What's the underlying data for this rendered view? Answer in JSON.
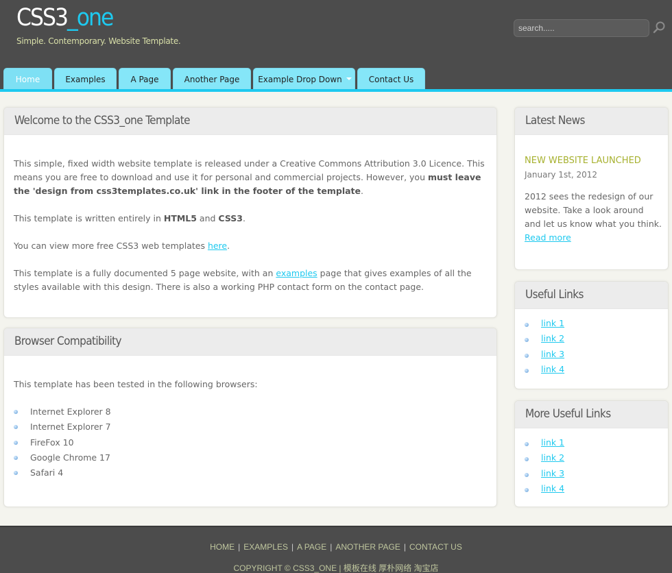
{
  "header": {
    "logo_main": "CSS3",
    "logo_accent": "_one",
    "slogan": "Simple. Contemporary. Website Template.",
    "search_placeholder": "search.....",
    "search_icon": "magnifier-icon"
  },
  "nav": {
    "tabs": [
      {
        "label": "Home"
      },
      {
        "label": "Examples"
      },
      {
        "label": "A Page"
      },
      {
        "label": "Another Page"
      },
      {
        "label": "Example Drop Down"
      },
      {
        "label": "Contact Us"
      }
    ]
  },
  "welcome": {
    "title": "Welcome to the CSS3_one Template",
    "p1_a": "This simple, fixed width website template is released under a Creative Commons Attribution 3.0 Licence. This means you are free to download and use it for personal and commercial projects. However, you ",
    "p1_b": "must leave the 'design from css3templates.co.uk' link in the footer of the template",
    "p1_c": ".",
    "p2_a": "This template is written entirely in ",
    "p2_b": "HTML5",
    "p2_c": " and ",
    "p2_d": "CSS3",
    "p2_e": ".",
    "p3_a": "You can view more free CSS3 web templates ",
    "p3_link": "here",
    "p3_c": ".",
    "p4_a": "This template is a fully documented 5 page website, with an ",
    "p4_link": "examples",
    "p4_c": " page that gives examples of all the styles available with this design. There is also a working PHP contact form on the contact page."
  },
  "browser": {
    "title": "Browser Compatibility",
    "intro": "This template has been tested in the following browsers:",
    "items": [
      "Internet Explorer 8",
      "Internet Explorer 7",
      "FireFox 10",
      "Google Chrome 17",
      "Safari 4"
    ]
  },
  "news": {
    "title": "Latest News",
    "headline": "NEW WEBSITE LAUNCHED",
    "date": "January 1st, 2012",
    "body": "2012 sees the redesign of our website. Take a look around and let us know what you think.",
    "read_more": "Read more"
  },
  "useful_links": {
    "title": "Useful Links",
    "items": [
      "link 1",
      "link 2",
      "link 3",
      "link 4"
    ]
  },
  "more_links": {
    "title": "More Useful Links",
    "items": [
      "link 1",
      "link 2",
      "link 3",
      "link 4"
    ]
  },
  "footer": {
    "links": [
      "HOME",
      "EXAMPLES",
      "A PAGE",
      "ANOTHER PAGE",
      "CONTACT US"
    ],
    "separator": "|",
    "copyright": "COPYRIGHT © CSS3_ONE | 模板在线 厚朴网络 淘宝店"
  },
  "colors": {
    "header_bg": "#4c4c4c",
    "accent": "#1ec9ef",
    "tab_bg": "#85e6f8",
    "news_headline": "#a7b12f",
    "slogan": "#d8dfa8"
  }
}
